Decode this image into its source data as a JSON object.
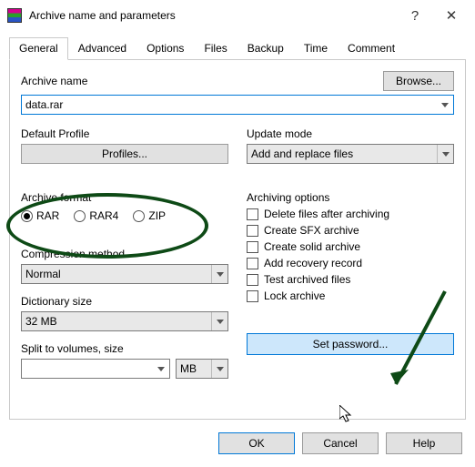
{
  "titlebar": {
    "title": "Archive name and parameters",
    "help_glyph": "?",
    "close_glyph": "✕"
  },
  "tabs": {
    "items": [
      {
        "label": "General"
      },
      {
        "label": "Advanced"
      },
      {
        "label": "Options"
      },
      {
        "label": "Files"
      },
      {
        "label": "Backup"
      },
      {
        "label": "Time"
      },
      {
        "label": "Comment"
      }
    ],
    "active_index": 0
  },
  "archive_name": {
    "label": "Archive name",
    "value": "data.rar",
    "browse_label": "Browse..."
  },
  "default_profile": {
    "label": "Default Profile",
    "button_label": "Profiles..."
  },
  "archive_format": {
    "label": "Archive format",
    "options": [
      {
        "label": "RAR",
        "selected": true
      },
      {
        "label": "RAR4",
        "selected": false
      },
      {
        "label": "ZIP",
        "selected": false
      }
    ]
  },
  "compression_method": {
    "label": "Compression method",
    "value": "Normal"
  },
  "dictionary_size": {
    "label": "Dictionary size",
    "value": "32 MB"
  },
  "split_volumes": {
    "label": "Split to volumes, size",
    "value": "",
    "unit": "MB"
  },
  "update_mode": {
    "label": "Update mode",
    "value": "Add and replace files"
  },
  "archiving_options": {
    "label": "Archiving options",
    "items": [
      {
        "label": "Delete files after archiving",
        "checked": false
      },
      {
        "label": "Create SFX archive",
        "checked": false
      },
      {
        "label": "Create solid archive",
        "checked": false
      },
      {
        "label": "Add recovery record",
        "checked": false
      },
      {
        "label": "Test archived files",
        "checked": false
      },
      {
        "label": "Lock archive",
        "checked": false
      }
    ]
  },
  "set_password_label": "Set password...",
  "footer": {
    "ok": "OK",
    "cancel": "Cancel",
    "help": "Help"
  },
  "annotation": {
    "oval_color": "#0e4a16",
    "arrow_color": "#0e4a16"
  }
}
